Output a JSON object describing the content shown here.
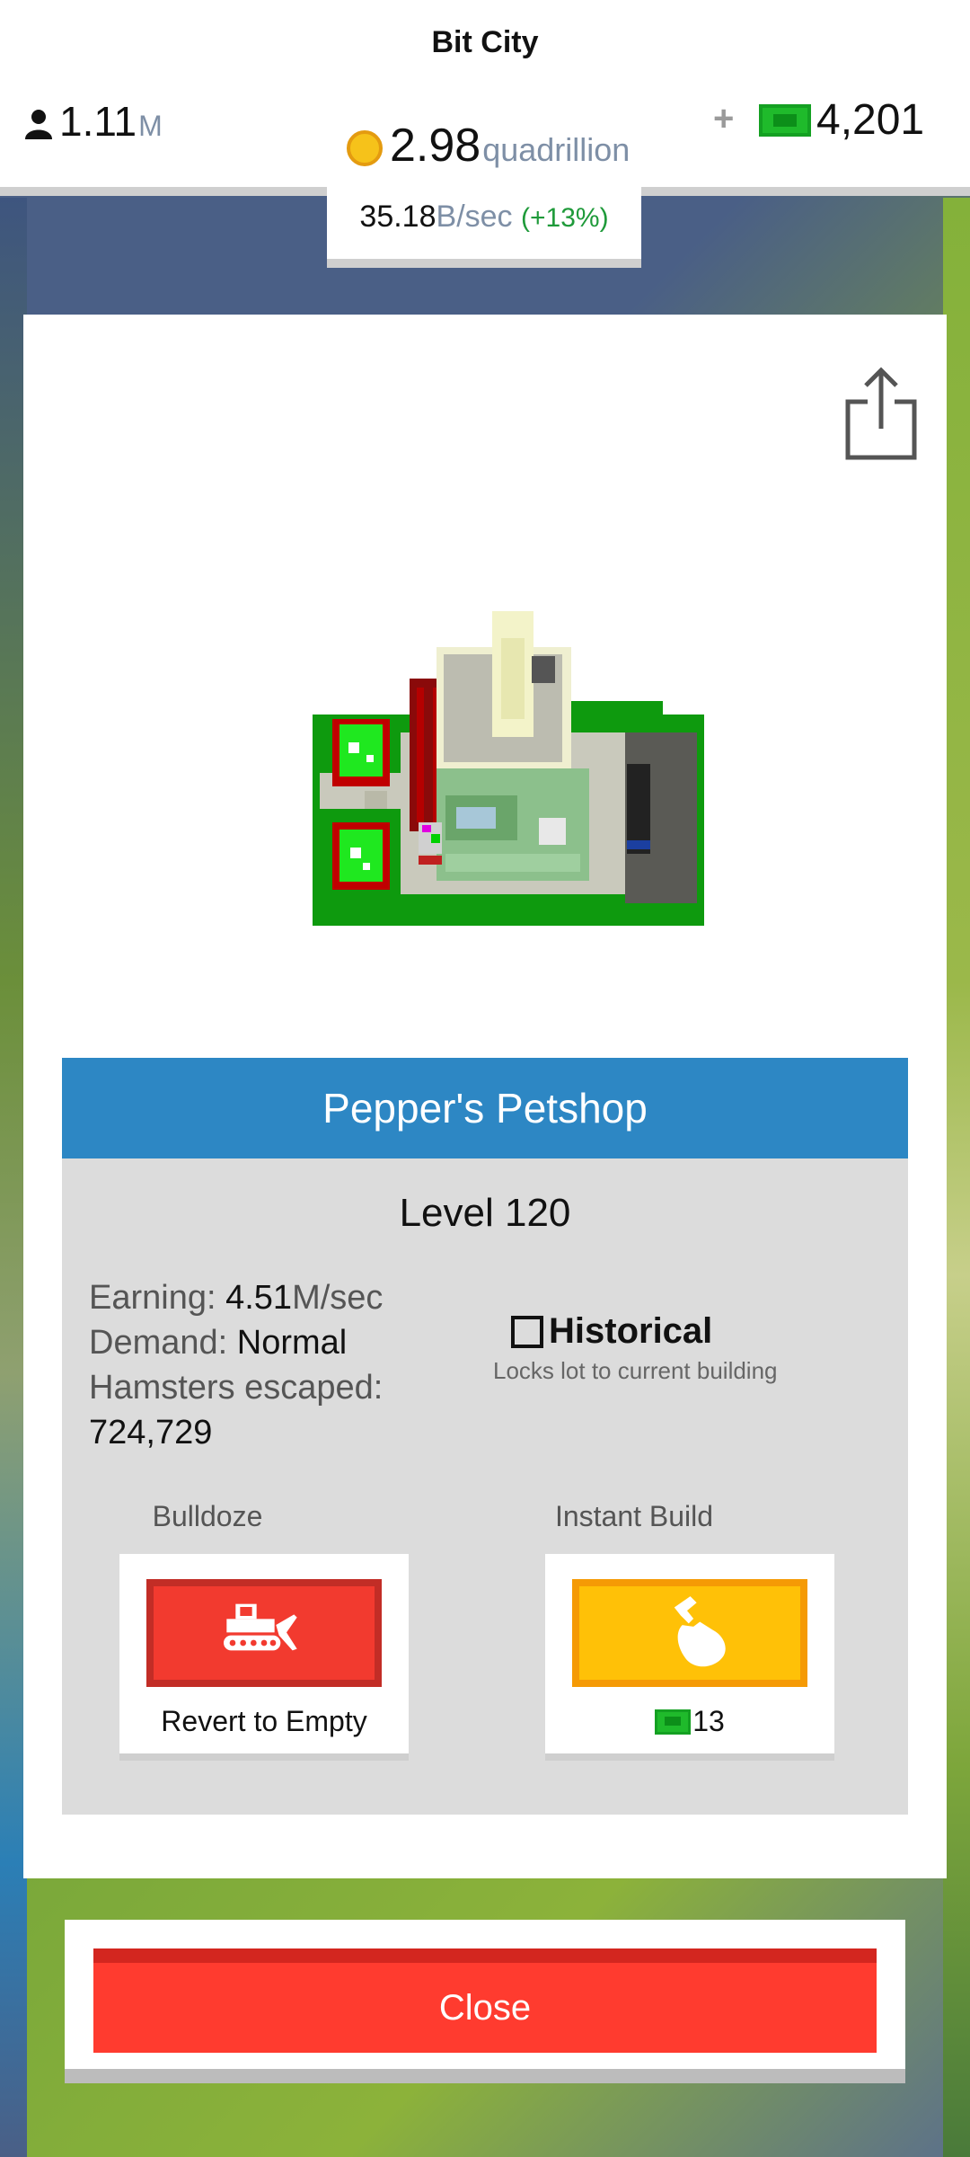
{
  "header": {
    "city_name": "Bit City",
    "population": {
      "value": "1.11",
      "unit": "M",
      "icon": "person-icon"
    },
    "coins": {
      "value": "2.98",
      "unit": "quadrillion",
      "icon": "coin-icon"
    },
    "plus": "+",
    "cash": {
      "value": "4,201",
      "icon": "cash-icon"
    },
    "rate": {
      "value": "35.18",
      "unit": "B/sec",
      "bonus": "(+13%)"
    }
  },
  "dialog": {
    "share_icon": "share-icon",
    "building_name": "Pepper's Petshop",
    "level": "Level 120",
    "stats": {
      "earning_label": "Earning: ",
      "earning_value": "4.51",
      "earning_unit": "M/sec",
      "demand_label": "Demand: ",
      "demand_value": "Normal",
      "hamsters_label": "Hamsters escaped:",
      "hamsters_value": "724,729"
    },
    "historical": {
      "checked": false,
      "label": "Historical",
      "subtitle": "Locks lot to current building"
    },
    "bulldoze": {
      "label": "Bulldoze",
      "icon": "bulldozer-icon",
      "caption": "Revert to Empty"
    },
    "instant_build": {
      "label": "Instant Build",
      "icon": "hammer-hand-icon",
      "cost": "13"
    }
  },
  "close_label": "Close",
  "colors": {
    "title_bar": "#2d87c4",
    "bulldoze": "#f23a2f",
    "instant_build": "#ffc107",
    "close": "#ff3b2f",
    "cash": "#1fba2b",
    "coin": "#f6c21a"
  }
}
